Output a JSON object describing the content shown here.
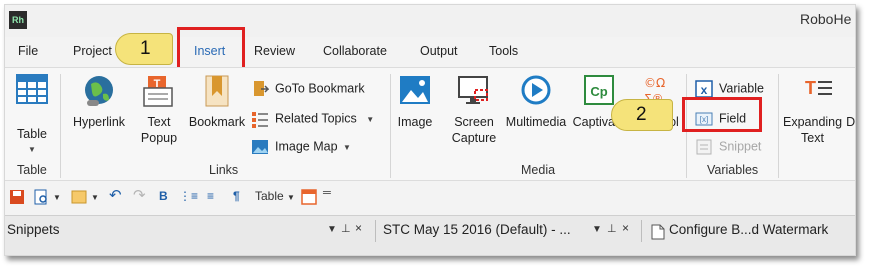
{
  "app": {
    "logo": "Rh",
    "title": "RoboHe"
  },
  "menu": [
    "File",
    "Project",
    "Insert",
    "Review",
    "Collaborate",
    "Output",
    "Tools"
  ],
  "ribbon": {
    "table": {
      "label": "Table",
      "group": "Table",
      "icon": "table-grid-icon"
    },
    "links": {
      "group": "Links",
      "hyperlink": "Hyperlink",
      "text_popup_line1": "Text",
      "text_popup_line2": "Popup",
      "bookmark": "Bookmark",
      "goto_bookmark": "GoTo Bookmark",
      "related_topics": "Related Topics",
      "image_map": "Image Map"
    },
    "media": {
      "group": "Media",
      "image": "Image",
      "screen_capture_line1": "Screen",
      "screen_capture_line2": "Capture",
      "multimedia": "Multimedia",
      "captivate": "Captivate",
      "symbol": "Symbol"
    },
    "variables": {
      "group": "Variables",
      "variable": "Variable",
      "field": "Field",
      "snippet": "Snippet"
    },
    "expanding": {
      "line1": "Expanding",
      "line2": "Text",
      "cut": "D"
    }
  },
  "callouts": [
    "1",
    "2"
  ],
  "quick_toolbar": {
    "table_label": "Table"
  },
  "panes": {
    "snippets": "Snippets",
    "doc1": "STC May 15 2016 (Default) - ...",
    "doc2": "Configure B...d Watermark"
  },
  "colors": {
    "highlight": "#e02020",
    "callout": "#f5e37a",
    "active_tab": "#2a6ab5"
  }
}
